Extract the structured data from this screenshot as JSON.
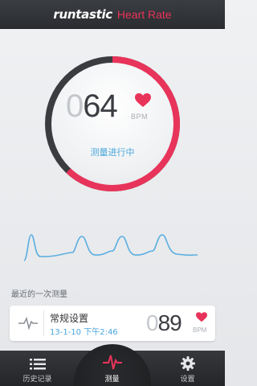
{
  "header": {
    "brand": "runtastic",
    "title": "Heart Rate"
  },
  "meter": {
    "bpm_dim": "0",
    "bpm_main": "64",
    "unit": "BPM",
    "status": "测量进行中",
    "progress": 0.62
  },
  "recent": {
    "section_label": "最近的一次测量",
    "title": "常规设置",
    "date": "13-1-10 下午2:46",
    "bpm_dim": "0",
    "bpm_main": "89",
    "unit": "BPM"
  },
  "tabs": [
    {
      "label": "历史记录",
      "icon": "list-icon"
    },
    {
      "label": "测量",
      "icon": "pulse-icon"
    },
    {
      "label": "设置",
      "icon": "gear-icon"
    }
  ],
  "colors": {
    "accent": "#e8345a",
    "blue": "#4aa6dd",
    "dark": "#2b2d31"
  }
}
